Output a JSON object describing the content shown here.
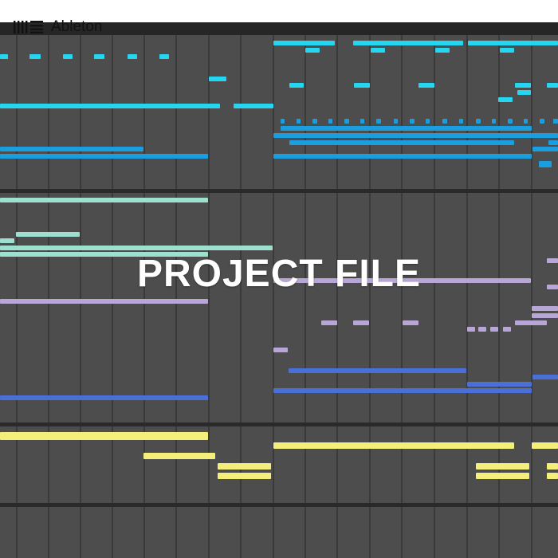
{
  "app": {
    "brand_name": "Ableton",
    "logo_icon": "ableton-logo-icon",
    "overlay_title": "PROJECT FILE"
  },
  "colors": {
    "background": "#4d4d4d",
    "cyan_clip": "#25d6f0",
    "blue_clip": "#1a9ee0",
    "teal_clip": "#9ee0d0",
    "lavender_clip": "#b8a6d6",
    "indigo_clip": "#4a70d8",
    "yellow_clip": "#f4ef7a"
  }
}
